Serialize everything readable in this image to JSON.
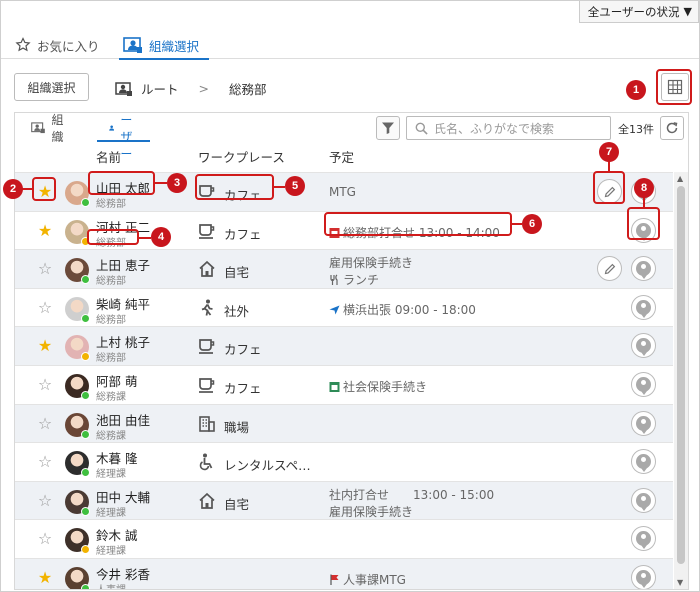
{
  "status_button": {
    "label": "全ユーザーの状況",
    "arrow": "▼"
  },
  "top_tabs": [
    {
      "label": "お気に入り",
      "icon": "star-outline-icon"
    },
    {
      "label": "組織選択",
      "icon": "org-chart-icon",
      "active": true
    }
  ],
  "org_select_button": "組織選択",
  "breadcrumb": {
    "root": "ルート",
    "separator": ">",
    "current": "総務部"
  },
  "sub_tabs": [
    {
      "label": "組織",
      "icon": "org-icon"
    },
    {
      "label": "ユーザー",
      "icon": "user-icon",
      "active": true
    }
  ],
  "search": {
    "placeholder": "氏名、ふりがなで検索"
  },
  "count": "全13件",
  "columns": {
    "name": "名前",
    "workplace": "ワークプレース",
    "schedule": "予定"
  },
  "colors": {
    "accent": "#1a73c8",
    "star": "#f2b300",
    "annotation": "#c8161d",
    "online": "#3fbf3f",
    "away": "#f2b300"
  },
  "users": [
    {
      "favorite": true,
      "name": "山田 太郎",
      "dept": "総務部",
      "presence": "online",
      "workplace": "カフェ",
      "wp_icon": "cup-icon",
      "schedule": [
        {
          "text": "MTG",
          "icon": ""
        }
      ],
      "editable": true
    },
    {
      "favorite": true,
      "name": "河村 正二",
      "dept": "総務部",
      "presence": "away",
      "workplace": "カフェ",
      "wp_icon": "cup-icon",
      "schedule": [
        {
          "text": "総務部打合せ 13:00 - 14:00",
          "icon": "red-calendar-icon"
        }
      ],
      "editable": false
    },
    {
      "favorite": false,
      "name": "上田 恵子",
      "dept": "総務部",
      "presence": "online",
      "workplace": "自宅",
      "wp_icon": "home-icon",
      "schedule": [
        {
          "text": "雇用保険手続き",
          "icon": ""
        },
        {
          "text": "ランチ",
          "icon": "fork-knife-icon"
        }
      ],
      "editable": true
    },
    {
      "favorite": false,
      "name": "柴崎 純平",
      "dept": "総務部",
      "presence": "online",
      "workplace": "社外",
      "wp_icon": "walking-icon",
      "schedule": [
        {
          "text": "横浜出張 09:00 - 18:00",
          "icon": "airplane-icon"
        }
      ],
      "editable": false
    },
    {
      "favorite": true,
      "name": "上村 桃子",
      "dept": "総務部",
      "presence": "away",
      "workplace": "カフェ",
      "wp_icon": "cup-icon",
      "schedule": [],
      "editable": false
    },
    {
      "favorite": false,
      "name": "阿部 萌",
      "dept": "総務課",
      "presence": "online",
      "workplace": "カフェ",
      "wp_icon": "cup-icon",
      "schedule": [
        {
          "text": "社会保険手続き",
          "icon": "green-calendar-icon"
        }
      ],
      "editable": false
    },
    {
      "favorite": false,
      "name": "池田 由佳",
      "dept": "総務課",
      "presence": "online",
      "workplace": "職場",
      "wp_icon": "building-icon",
      "schedule": [],
      "editable": false
    },
    {
      "favorite": false,
      "name": "木暮 隆",
      "dept": "経理課",
      "presence": "online",
      "workplace": "レンタルスペ…",
      "wp_icon": "wheelchair-icon",
      "schedule": [],
      "editable": false
    },
    {
      "favorite": false,
      "name": "田中 大輔",
      "dept": "経理課",
      "presence": "online",
      "workplace": "自宅",
      "wp_icon": "home-icon",
      "schedule": [
        {
          "text": "社内打合せ　　13:00 - 15:00",
          "icon": ""
        },
        {
          "text": "雇用保険手続き",
          "icon": ""
        }
      ],
      "editable": false
    },
    {
      "favorite": false,
      "name": "鈴木 誠",
      "dept": "経理課",
      "presence": "away",
      "workplace": "",
      "wp_icon": "",
      "schedule": [],
      "editable": false
    },
    {
      "favorite": true,
      "name": "今井 彩香",
      "dept": "人事課",
      "presence": "online",
      "workplace": "",
      "wp_icon": "",
      "schedule": [
        {
          "text": "人事課MTG",
          "icon": "red-flag-icon"
        }
      ],
      "editable": false
    }
  ],
  "annotations": [
    "1",
    "2",
    "3",
    "4",
    "5",
    "6",
    "7",
    "8"
  ]
}
